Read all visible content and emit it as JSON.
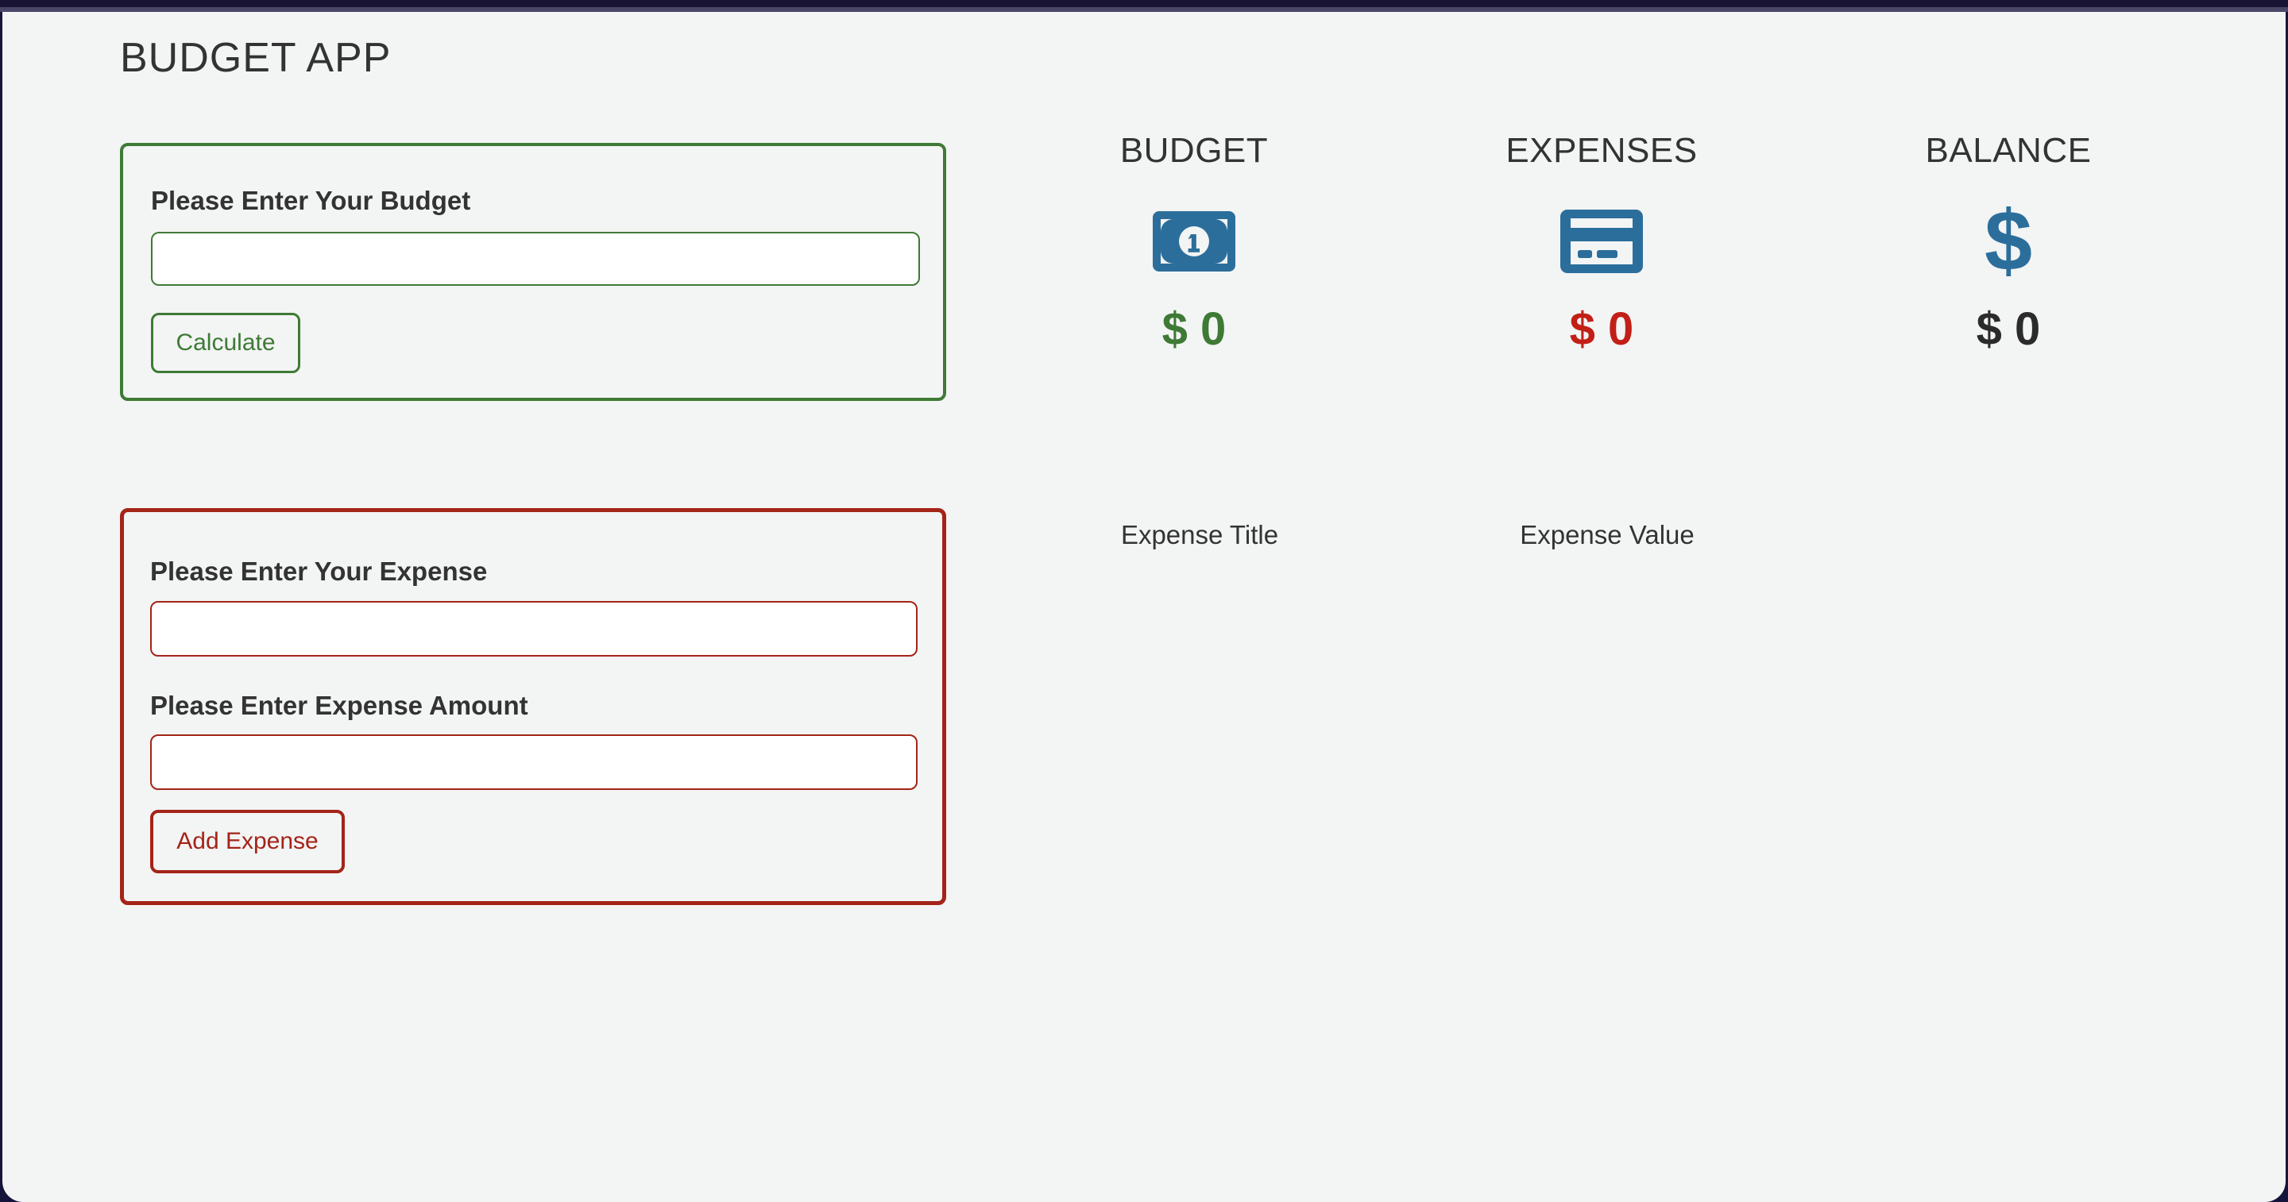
{
  "app": {
    "title": "BUDGET APP"
  },
  "colors": {
    "background": "#f3f4f4",
    "chrome": "#1a1434",
    "green": "#3e7a35",
    "red": "#a42418",
    "value_red": "#c21f17",
    "icon_blue": "#2c6e9b",
    "text_dark": "#333333"
  },
  "budget_form": {
    "label": "Please Enter Your Budget",
    "input_value": "",
    "input_placeholder": "",
    "submit_label": "Calculate"
  },
  "expense_form": {
    "title_label": "Please Enter Your Expense",
    "title_value": "",
    "title_placeholder": "",
    "amount_label": "Please Enter Expense Amount",
    "amount_value": "",
    "amount_placeholder": "",
    "submit_label": "Add Expense"
  },
  "summary": {
    "budget": {
      "heading": "BUDGET",
      "icon": "money-bill-icon",
      "value": "$ 0"
    },
    "expenses": {
      "heading": "EXPENSES",
      "icon": "credit-card-icon",
      "value": "$ 0"
    },
    "balance": {
      "heading": "BALANCE",
      "icon": "dollar-sign-icon",
      "value": "$ 0"
    }
  },
  "expense_list": {
    "column_title": "Expense Title",
    "column_value": "Expense Value",
    "rows": []
  }
}
